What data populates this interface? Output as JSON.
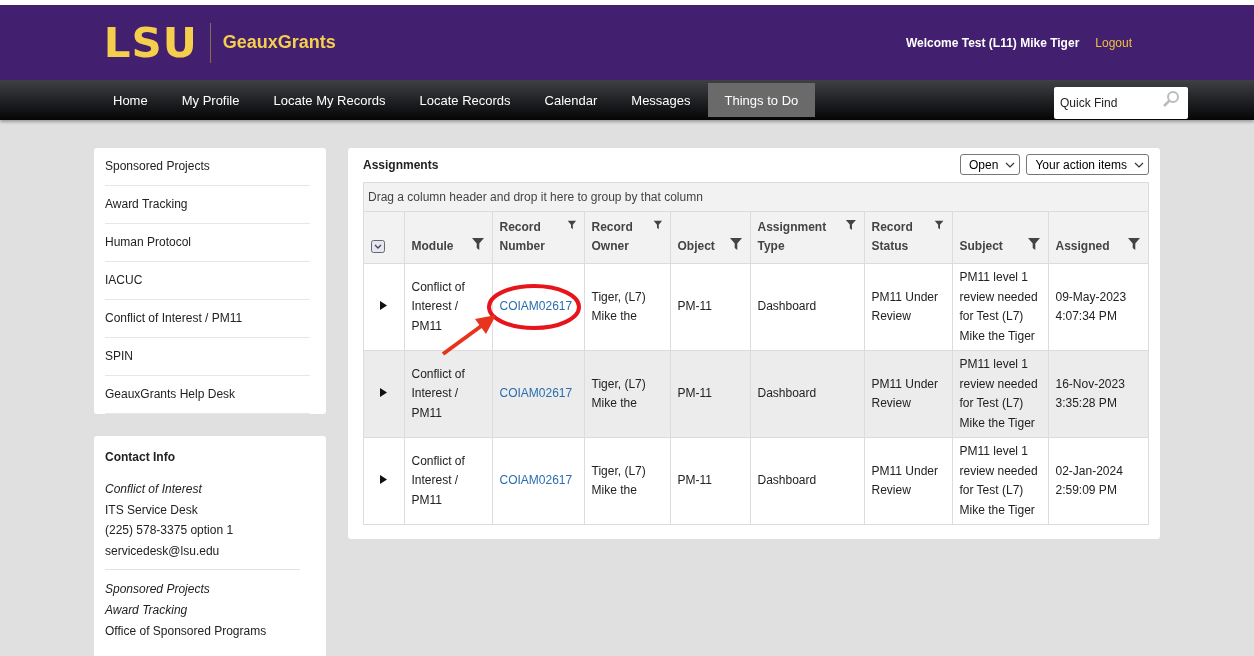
{
  "header": {
    "logo": "LSU",
    "app_name": "GeauxGrants",
    "welcome": "Welcome Test (L11) Mike Tiger",
    "logout": "Logout"
  },
  "nav": {
    "items": [
      {
        "label": "Home",
        "selected": false
      },
      {
        "label": "My Profile",
        "selected": false
      },
      {
        "label": "Locate My Records",
        "selected": false
      },
      {
        "label": "Locate Records",
        "selected": false
      },
      {
        "label": "Calendar",
        "selected": false
      },
      {
        "label": "Messages",
        "selected": false
      },
      {
        "label": "Things to Do",
        "selected": true
      }
    ],
    "search": {
      "placeholder": "Quick Find"
    }
  },
  "sidebar": {
    "items": [
      "Sponsored Projects",
      "Award Tracking",
      "Human Protocol",
      "IACUC",
      "Conflict of Interest / PM11",
      "SPIN",
      "GeauxGrants Help Desk"
    ]
  },
  "contact": {
    "title": "Contact Info",
    "groups": [
      {
        "lines": [
          {
            "text": "Conflict of Interest",
            "italic": true
          },
          {
            "text": "ITS Service Desk",
            "italic": false
          },
          {
            "text": "(225) 578-3375 option 1",
            "italic": false
          },
          {
            "text": "servicedesk@lsu.edu",
            "italic": false
          }
        ]
      },
      {
        "lines": [
          {
            "text": "Sponsored Projects",
            "italic": true
          },
          {
            "text": "Award Tracking",
            "italic": true
          },
          {
            "text": "Office of Sponsored Programs",
            "italic": false
          }
        ]
      }
    ]
  },
  "assignments": {
    "title": "Assignments",
    "filters": [
      "Open",
      "Your action items"
    ],
    "group_hint": "Drag a column header and drop it here to group by that column",
    "columns": [
      "Module",
      "Record Number",
      "Record Owner",
      "Object",
      "Assignment Type",
      "Record Status",
      "Subject",
      "Assigned"
    ],
    "rows": [
      {
        "highlighted": true,
        "cells": [
          "Conflict of Interest / PM11",
          "COIAM02617",
          "Tiger, (L7) Mike the",
          "PM-11",
          "Dashboard",
          "PM11 Under Review",
          "PM11 level 1 review needed for Test (L7) Mike the Tiger",
          "09-May-2023 4:07:34 PM"
        ]
      },
      {
        "highlighted": false,
        "cells": [
          "Conflict of Interest / PM11",
          "COIAM02617",
          "Tiger, (L7) Mike the",
          "PM-11",
          "Dashboard",
          "PM11 Under Review",
          "PM11 level 1 review needed for Test (L7) Mike the Tiger",
          "16-Nov-2023 3:35:28 PM"
        ]
      },
      {
        "highlighted": false,
        "cells": [
          "Conflict of Interest / PM11",
          "COIAM02617",
          "Tiger, (L7) Mike the",
          "PM-11",
          "Dashboard",
          "PM11 Under Review",
          "PM11 level 1 review needed for Test (L7) Mike the Tiger",
          "02-Jan-2024 2:59:09 PM"
        ]
      }
    ]
  }
}
